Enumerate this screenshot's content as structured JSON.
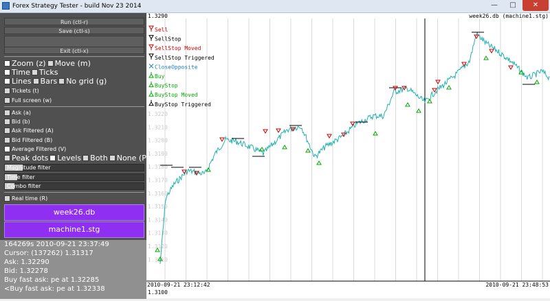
{
  "window": {
    "title": "Forex Strategy Tester - build Nov 23 2014"
  },
  "panel": {
    "run_label": "Run (ctl-r)",
    "save_label": "Save (ctl-s)",
    "exit_label": "Exit (ctl-x)",
    "zoom_label": "Zoom (z)",
    "move_label": "Move (m)",
    "time_label": "Time",
    "ticks_label": "Ticks",
    "lines_label": "Lines",
    "bars_label": "Bars",
    "nogrid_label": "No grid (g)",
    "tickets_label": "Tickets (t)",
    "fullscreen_label": "Full screen (w)",
    "ask_label": "Ask (a)",
    "bid_label": "Bid (b)",
    "ask_filtered_label": "Ask Filtered (A)",
    "bid_filtered_label": "Bid Filtered (B)",
    "avg_filtered_label": "Average Filtered (V)",
    "peak_dots_label": "Peak dots",
    "levels_label": "Levels",
    "both_label": "Both",
    "none_label": "None (P)",
    "magnitude_filter_label": "Magnitude filter",
    "time_filter_label": "Time filter",
    "combo_filter_label": "Combo filter",
    "realtime_label": "Real time (R)",
    "db_name": "week26.db",
    "strategy_name": "machine1.stg"
  },
  "info": {
    "line1": "164269s 2010-09-21 23:37:49",
    "line2": "Cursor: (137262) 1.31317",
    "line3": "Ask: 1.32290",
    "line4": "Bid: 1.32278",
    "line5": "Buy fast ask: pe at 1.32285",
    "line6": "<Buy fast ask: pe at 1.32338"
  },
  "chart": {
    "top_price": "1.3290",
    "bottom_price": "1.3100",
    "file_label": "week26.db (machine1.stg)",
    "start_time": "2010-09-21 23:12:42",
    "end_time": "2010-09-21 23:48:53",
    "line_color": "#20b0b0",
    "sell_color": "#cc0000",
    "buy_color": "#00aa00",
    "legend": [
      {
        "label": "Sell",
        "icon": "sell-icon",
        "color": "#cc0000"
      },
      {
        "label": "SellStop",
        "icon": "sellstop-icon",
        "color": "#000000"
      },
      {
        "label": "SellStop Moved",
        "icon": "sellstop-moved-icon",
        "color": "#cc0000"
      },
      {
        "label": "SellStop Triggered",
        "icon": "sellstop-triggered-icon",
        "color": "#000000"
      },
      {
        "label": "CloseOpposite",
        "icon": "close-opposite-icon",
        "color": "#2080c0"
      },
      {
        "label": "Buy",
        "icon": "buy-icon",
        "color": "#00aa00"
      },
      {
        "label": "BuyStop",
        "icon": "buystop-icon",
        "color": "#00aa00"
      },
      {
        "label": "BuyStop Moved",
        "icon": "buystop-moved-icon",
        "color": "#00aa00"
      },
      {
        "label": "BuyStop Triggered",
        "icon": "buystop-triggered-icon",
        "color": "#000000"
      }
    ],
    "y_labels": [
      "1.3220",
      "1.3210",
      "1.3200",
      "1.3190",
      "1.3180",
      "1.3170",
      "1.3160",
      "1.3150",
      "1.3140",
      "1.3130",
      "1.3120",
      "1.3110"
    ]
  }
}
